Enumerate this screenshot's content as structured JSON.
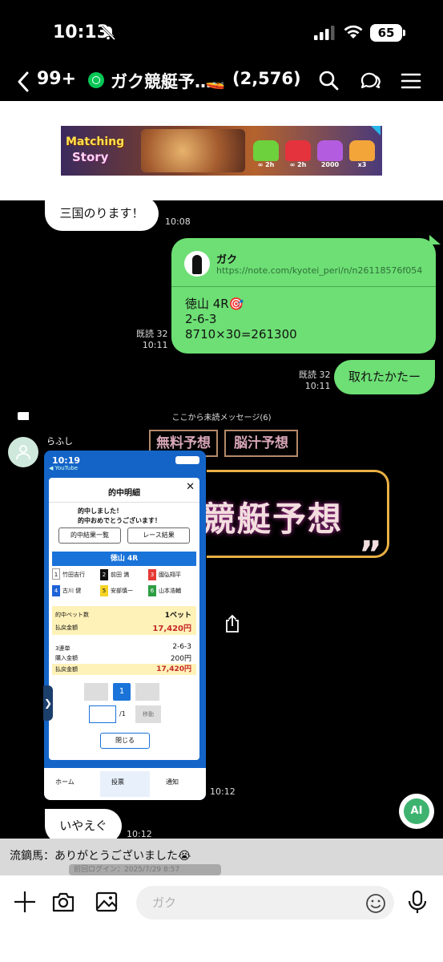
{
  "status": {
    "time": "10:13",
    "battery": "65"
  },
  "header": {
    "unread_count": "99+",
    "title": "ガク競艇予…",
    "title_emoji": "🚤",
    "member_count": "(2,576)"
  },
  "ad": {
    "brand_line1": "Matching",
    "brand_line2": "Story",
    "chest_labels": [
      "∞ 2h",
      "∞ 2h",
      "2000",
      "x3"
    ]
  },
  "messages": {
    "m1": {
      "text": "三国のります！",
      "time": "10:08"
    },
    "card": {
      "sender": "ガク",
      "url": "https://note.com/kyotei_peri/n/n26118576f054",
      "line1": "徳山 4R🎯",
      "line2": "2-6-3",
      "line3": "8710×30=261300",
      "read": "既読 32",
      "time": "10:11"
    },
    "m2": {
      "text": "取れたかたー",
      "read": "既読 32",
      "time": "10:11"
    },
    "unread_separator": "ここから未読メッセージ(6)",
    "user": "らふし",
    "image_time": "10:12",
    "m3": {
      "text": "いやえぐ",
      "time": "10:12"
    }
  },
  "poster": {
    "pill1": "無料予想",
    "pill2": "脳汁予想",
    "big": "競艇予想",
    "quote": "”"
  },
  "screenshot": {
    "time": "10:19",
    "app": "◀ YouTube",
    "title": "的中明細",
    "close": "✕",
    "congrats1": "的中しました！",
    "congrats2": "的中おめでとうございます！",
    "btn1": "的中結果一覧",
    "btn2": "レース結果",
    "race": "徳山 4R",
    "racers": [
      {
        "num": "1",
        "name": "竹田吉行",
        "color": "#ffffff",
        "fg": "#111111"
      },
      {
        "num": "2",
        "name": "前田 満",
        "color": "#111111",
        "fg": "#ffffff"
      },
      {
        "num": "3",
        "name": "國弘翔平",
        "color": "#e53935",
        "fg": "#ffffff"
      },
      {
        "num": "4",
        "name": "古川 健",
        "color": "#1e63d6",
        "fg": "#ffffff"
      },
      {
        "num": "5",
        "name": "安部慎一",
        "color": "#f6d325",
        "fg": "#111111"
      },
      {
        "num": "6",
        "name": "山本浩輔",
        "color": "#2e9e44",
        "fg": "#ffffff"
      }
    ],
    "hit_bets_label": "的中ベット数",
    "hit_bets_value": "1ベット",
    "payout_label": "払戻金額",
    "payout_value": "17,420円",
    "trifecta_label": "3連単",
    "trifecta_value": "2-6-3",
    "purchase_label": "購入金額",
    "purchase_value": "200円",
    "payout2_label": "払戻金額",
    "payout2_value": "17,420円",
    "page_current": "1",
    "page_total": "/1",
    "jump": "移動",
    "close_button": "閉じる",
    "tab_home": "ホーム",
    "tab_vote": "投票",
    "tab_notice": "通知"
  },
  "ai_button": "AI",
  "notice": {
    "text": "流鏑馬：ありがとうございました😭",
    "ghost": "前回ログイン：2025/7/29 8:57"
  },
  "input": {
    "placeholder": "ガク"
  }
}
